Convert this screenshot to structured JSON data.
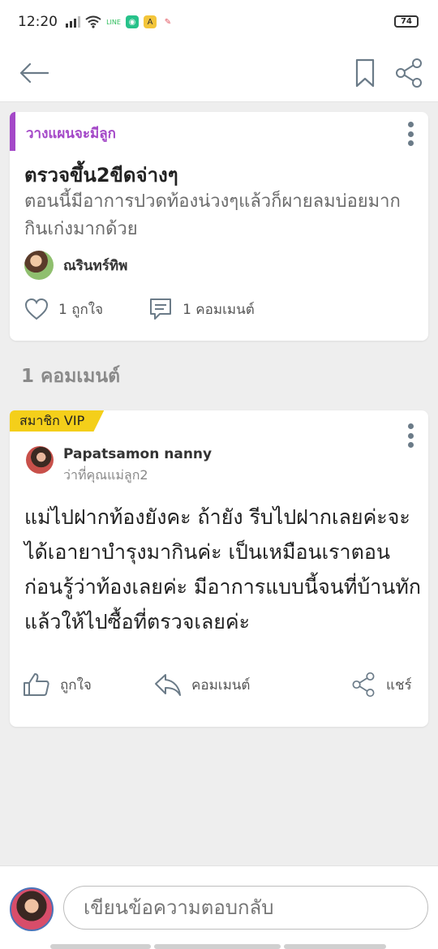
{
  "status": {
    "time": "12:20",
    "battery": "74"
  },
  "post": {
    "category": "วางแผนจะมีลูก",
    "title": "ตรวจขึ้น2ขีดจ่างๆ",
    "body": "ตอนนี้มีอาการปวดท้องน่วงๆแล้วก็ผายลมบ่อยมากกินเก่งมากด้วย",
    "author": "ณรินทร์ทิพ",
    "likes": "1 ถูกใจ",
    "comments": "1 คอมเมนต์"
  },
  "comments_header": "1 คอมเมนต์",
  "comment": {
    "badge": "สมาชิก VIP",
    "author": "Papatsamon nanny",
    "subtitle": "ว่าที่คุณแม่ลูก2",
    "body": "แม่ไปฝากท้องยังคะ ถ้ายัง รีบไปฝากเลยค่ะจะได้เอายาบำรุงมากินค่ะ เป็นเหมือนเราตอนก่อนรู้ว่าท้องเลยค่ะ มีอาการแบบนี้จนที่บ้านทัก แล้วให้ไปซื้อที่ตรวจเลยค่ะ",
    "like_label": "ถูกใจ",
    "reply_label": "คอมเมนต์",
    "share_label": "แชร์"
  },
  "reply": {
    "placeholder": "เขียนข้อความตอบกลับ"
  },
  "colors": {
    "category": "#a448c8",
    "vip": "#f4cf1a",
    "icon": "#6b7b88"
  }
}
